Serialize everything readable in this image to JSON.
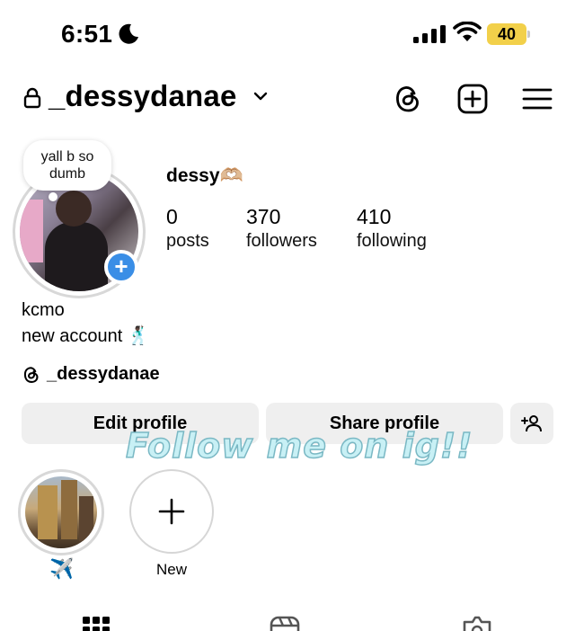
{
  "status_bar": {
    "time": "6:51",
    "battery": "40",
    "battery_color": "#f2d04a"
  },
  "header": {
    "username": "_dessydanae",
    "icons": [
      "lock-icon",
      "chevron-down-icon",
      "threads-icon",
      "create-icon",
      "menu-icon"
    ]
  },
  "profile": {
    "note": "yall b so dumb",
    "display_name": "dessy🫶🏼",
    "stats": [
      {
        "value": "0",
        "label": "posts"
      },
      {
        "value": "370",
        "label": "followers"
      },
      {
        "value": "410",
        "label": "following"
      }
    ],
    "bio_line1": "kcmo",
    "bio_line2": "new account 🕺🏿",
    "threads_handle": "_dessydanae"
  },
  "actions": {
    "edit_profile": "Edit profile",
    "share_profile": "Share profile"
  },
  "overlay_text": "Follow me on ig!!",
  "highlights": [
    {
      "label": "✈️"
    },
    {
      "label": "New"
    }
  ],
  "accent_color": "#3a8ee6"
}
